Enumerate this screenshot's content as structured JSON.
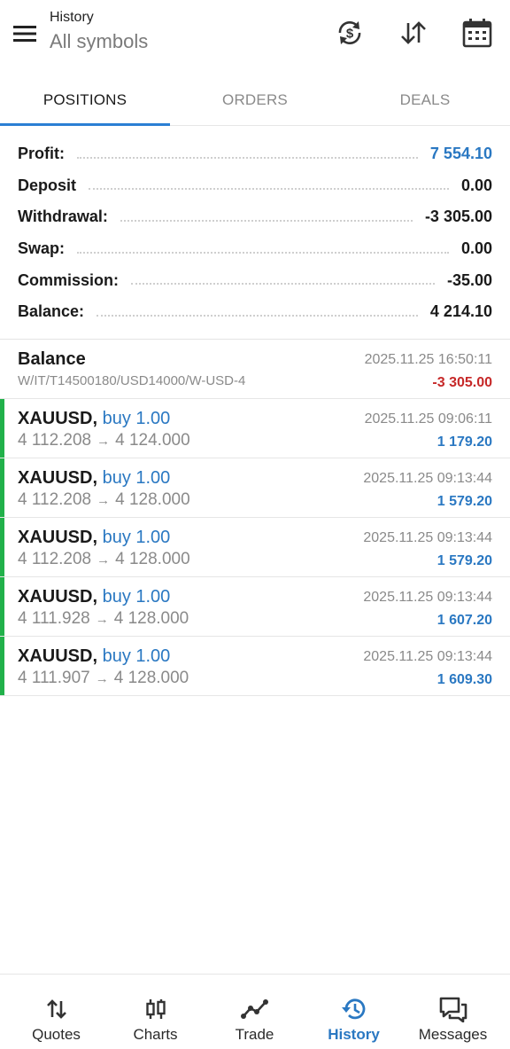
{
  "header": {
    "title": "History",
    "subtitle": "All symbols"
  },
  "tabs": [
    {
      "label": "POSITIONS",
      "active": true
    },
    {
      "label": "ORDERS",
      "active": false
    },
    {
      "label": "DEALS",
      "active": false
    }
  ],
  "summary": [
    {
      "label": "Profit:",
      "value": "7 554.10"
    },
    {
      "label": "Deposit",
      "value": "0.00"
    },
    {
      "label": "Withdrawal:",
      "value": "-3 305.00"
    },
    {
      "label": "Swap:",
      "value": "0.00"
    },
    {
      "label": "Commission:",
      "value": "-35.00"
    },
    {
      "label": "Balance:",
      "value": "4 214.10"
    }
  ],
  "balance_record": {
    "title": "Balance",
    "description": "W/IT/T14500180/USD14000/W-USD-4",
    "time": "2025.11.25 16:50:11",
    "amount": "-3 305.00"
  },
  "positions": [
    {
      "symbol": "XAUUSD,",
      "side": "buy 1.00",
      "open": "4 112.208",
      "close": "4 124.000",
      "time": "2025.11.25 09:06:11",
      "profit": "1 179.20"
    },
    {
      "symbol": "XAUUSD,",
      "side": "buy 1.00",
      "open": "4 112.208",
      "close": "4 128.000",
      "time": "2025.11.25 09:13:44",
      "profit": "1 579.20"
    },
    {
      "symbol": "XAUUSD,",
      "side": "buy 1.00",
      "open": "4 112.208",
      "close": "4 128.000",
      "time": "2025.11.25 09:13:44",
      "profit": "1 579.20"
    },
    {
      "symbol": "XAUUSD,",
      "side": "buy 1.00",
      "open": "4 111.928",
      "close": "4 128.000",
      "time": "2025.11.25 09:13:44",
      "profit": "1 607.20"
    },
    {
      "symbol": "XAUUSD,",
      "side": "buy 1.00",
      "open": "4 111.907",
      "close": "4 128.000",
      "time": "2025.11.25 09:13:44",
      "profit": "1 609.30"
    }
  ],
  "arrow_glyph": "→",
  "nav": [
    {
      "label": "Quotes",
      "icon": "quotes-icon",
      "active": false
    },
    {
      "label": "Charts",
      "icon": "charts-icon",
      "active": false
    },
    {
      "label": "Trade",
      "icon": "trade-icon",
      "active": false
    },
    {
      "label": "History",
      "icon": "history-icon",
      "active": true
    },
    {
      "label": "Messages",
      "icon": "messages-icon",
      "active": false
    }
  ],
  "colors": {
    "accent": "#2a78c2",
    "loss": "#c62828",
    "position_bar": "#21b14a",
    "tab_underline": "#2b7fd4"
  }
}
